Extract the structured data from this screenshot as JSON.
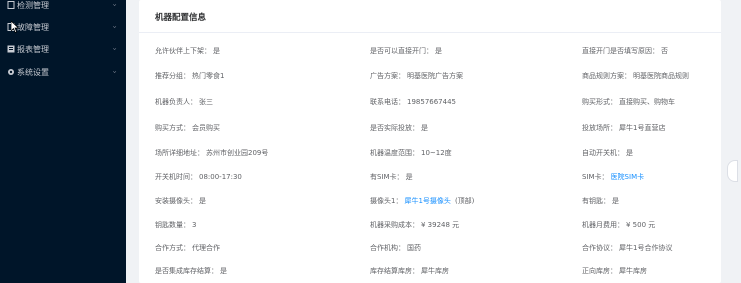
{
  "sidebar": {
    "items": [
      {
        "label": "检测管理",
        "icon": "document-icon"
      },
      {
        "label": "故障管理",
        "icon": "document-icon"
      },
      {
        "label": "报表管理",
        "icon": "report-icon"
      },
      {
        "label": "系统设置",
        "icon": "gear-icon"
      }
    ]
  },
  "card": {
    "title": "机器配置信息",
    "rows": [
      [
        {
          "k": "允许伙伴上下架：",
          "v": "是"
        },
        {
          "k": "是否可以直接开门：",
          "v": "是"
        },
        {
          "k": "直接开门是否填写原因：",
          "v": "否"
        }
      ],
      [
        {
          "k": "推荐分组：",
          "v": "热门零食1"
        },
        {
          "k": "广告方案：",
          "v": "明基医院广告方案"
        },
        {
          "k": "商品规则方案：",
          "v": "明基医院商品规则"
        }
      ],
      [
        {
          "k": "机器负责人：",
          "v": "张三"
        },
        {
          "k": "联系电话：",
          "v": "19857667445"
        },
        {
          "k": "购买形式：",
          "v": "直接购买、购物车"
        }
      ],
      [
        {
          "k": "购买方式：",
          "v": "会员购买"
        },
        {
          "k": "是否实际投放：",
          "v": "是"
        },
        {
          "k": "投放场所：",
          "v": "犀牛1号直营店"
        }
      ],
      [
        {
          "k": "场所详细地址：",
          "v": "苏州市创业园209号"
        },
        {
          "k": "机器温度范围：",
          "v": "10~12度"
        },
        {
          "k": "自动开关机：",
          "v": "是"
        }
      ],
      [
        {
          "k": "开关机时间：",
          "v": "08:00-17:30"
        },
        {
          "k": "有SIM卡：",
          "v": "是"
        },
        {
          "k": "SIM卡：",
          "v": "医院SIM卡",
          "link": true
        }
      ],
      [
        {
          "k": "安装摄像头：",
          "v": "是"
        },
        {
          "k": "摄像头1：",
          "v": "犀牛1号摄像头",
          "link": true,
          "extra": "(顶部)"
        },
        {
          "k": "有钥匙：",
          "v": "是"
        }
      ],
      [
        {
          "k": "钥匙数量：",
          "v": "3"
        },
        {
          "k": "机器采购成本：",
          "v": "¥ 39248 元"
        },
        {
          "k": "机器月费用：",
          "v": "¥ 500 元"
        }
      ],
      [
        {
          "k": "合作方式：",
          "v": "代理合作"
        },
        {
          "k": "合作机构：",
          "v": "国药"
        },
        {
          "k": "合作协议：",
          "v": "犀牛1号合作协议"
        }
      ],
      [
        {
          "k": "是否集成库存结算：",
          "v": "是"
        },
        {
          "k": "库存结算库房：",
          "v": "犀牛库房"
        },
        {
          "k": "正向库房：",
          "v": "犀牛库房"
        }
      ]
    ]
  }
}
